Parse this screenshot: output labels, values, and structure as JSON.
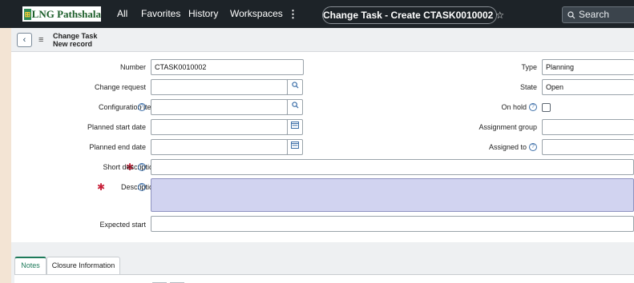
{
  "topbar": {
    "logo_mark": "⊞",
    "logo_text": "LNG Pathshala",
    "nav": [
      "All",
      "Favorites",
      "History",
      "Workspaces"
    ],
    "more_icon": "⋮",
    "page_title": "Change Task - Create CTASK0010002",
    "star_icon": "☆",
    "search_label": "Search"
  },
  "header": {
    "back_icon": "‹",
    "menu_icon": "≡",
    "title": "Change Task",
    "subtitle": "New record"
  },
  "form": {
    "number_label": "Number",
    "number_value": "CTASK0010002",
    "change_request_label": "Change request",
    "change_request_value": "",
    "configuration_item_label": "Configuration item",
    "configuration_item_value": "",
    "planned_start_label": "Planned start date",
    "planned_start_value": "",
    "planned_end_label": "Planned end date",
    "planned_end_value": "",
    "short_description_label": "Short description",
    "short_description_value": "",
    "description_label": "Description",
    "expected_start_label": "Expected start",
    "expected_start_value": "",
    "type_label": "Type",
    "type_value": "Planning",
    "state_label": "State",
    "state_value": "Open",
    "on_hold_label": "On hold",
    "on_hold_checked": false,
    "assignment_group_label": "Assignment group",
    "assignment_group_value": "",
    "assigned_to_label": "Assigned to",
    "assigned_to_value": "",
    "required_marker": "✱",
    "help_icon": "?"
  },
  "tabs": [
    {
      "label": "Notes",
      "active": true
    },
    {
      "label": "Closure Information",
      "active": false
    }
  ],
  "colors": {
    "topbar_bg": "#1d2328",
    "accent_green": "#1e7a5a",
    "required_red": "#c8213a",
    "description_fill": "#d1d3f0"
  }
}
